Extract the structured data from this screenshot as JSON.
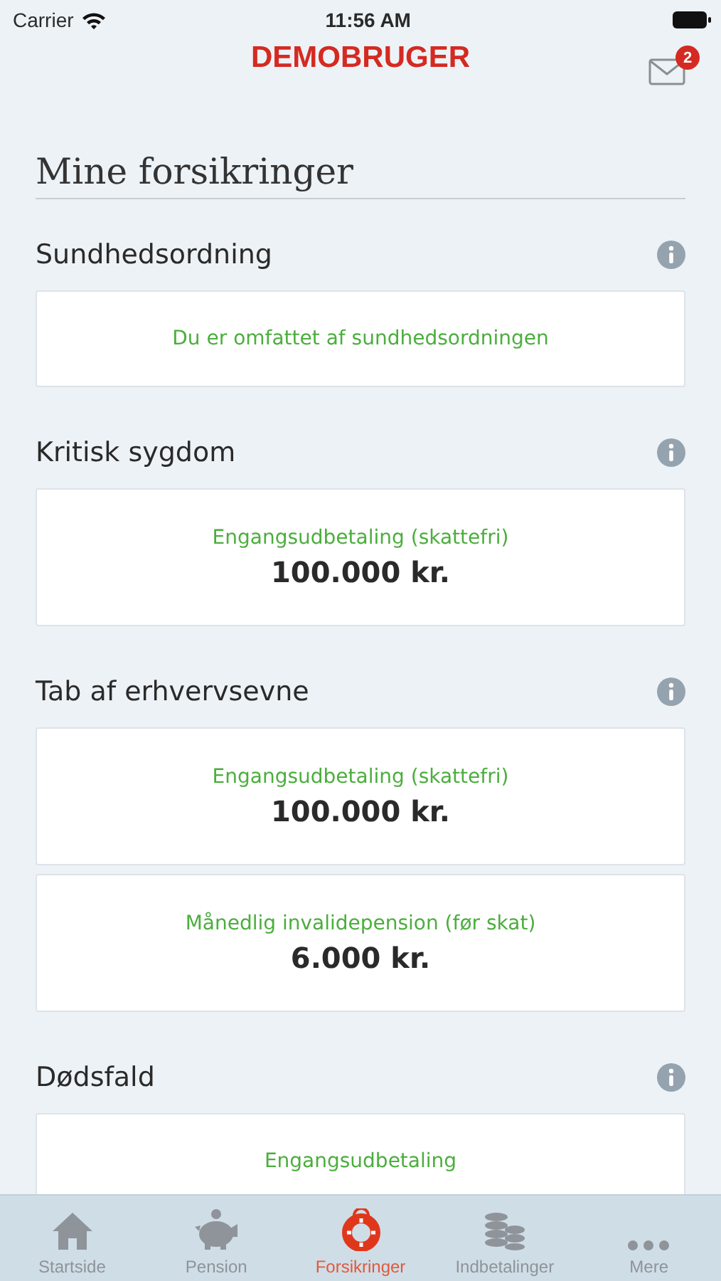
{
  "status_bar": {
    "carrier": "Carrier",
    "time": "11:56 AM"
  },
  "header": {
    "title": "DEMOBRUGER",
    "unread_count": "2"
  },
  "page_title": "Mine forsikringer",
  "sections": [
    {
      "heading": "Sundhedsordning",
      "cards": [
        {
          "kind": "text",
          "label": "Du er omfattet af sundhedsordningen"
        }
      ]
    },
    {
      "heading": "Kritisk sygdom",
      "cards": [
        {
          "kind": "amount",
          "label": "Engangsudbetaling (skattefri)",
          "amount": "100.000 kr."
        }
      ]
    },
    {
      "heading": "Tab af erhvervsevne",
      "cards": [
        {
          "kind": "amount",
          "label": "Engangsudbetaling (skattefri)",
          "amount": "100.000 kr."
        },
        {
          "kind": "amount",
          "label": "Månedlig invalidepension (før skat)",
          "amount": "6.000 kr."
        }
      ]
    },
    {
      "heading": "Dødsfald",
      "cards": [
        {
          "kind": "text",
          "label": "Engangsudbetaling"
        }
      ]
    }
  ],
  "tabs": [
    {
      "label": "Startside",
      "kind": "home",
      "selected": false
    },
    {
      "label": "Pension",
      "kind": "savings",
      "selected": false
    },
    {
      "label": "Forsikringer",
      "kind": "insurance",
      "selected": true
    },
    {
      "label": "Indbetalinger",
      "kind": "payments",
      "selected": false
    },
    {
      "label": "Mere",
      "kind": "more",
      "selected": false
    }
  ]
}
